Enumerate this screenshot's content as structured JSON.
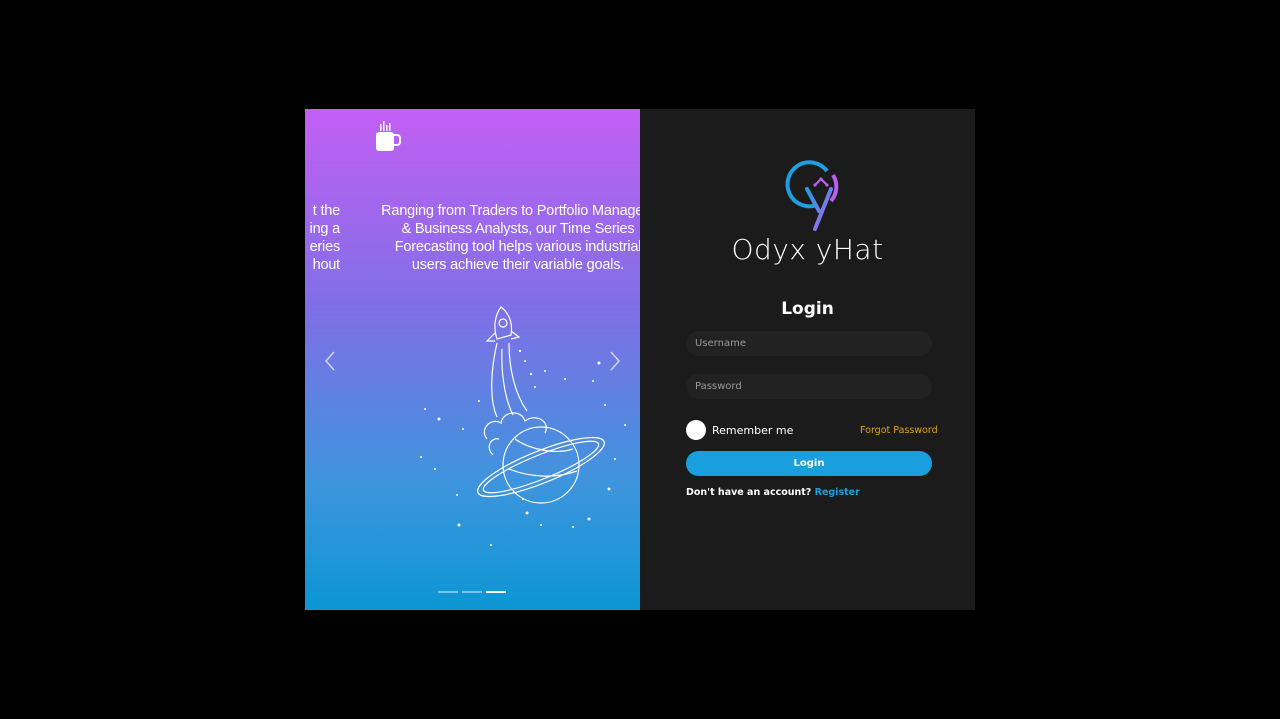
{
  "carousel": {
    "previous_slide_lines": [
      "t the",
      "ing a",
      "eries",
      "hout"
    ],
    "current_slide_lines": [
      "Ranging from Traders to Portfolio Managers",
      "& Business Analysts, our Time Series",
      "Forecasting tool helps various industrial",
      "users achieve their variable goals."
    ],
    "indicators": 3,
    "active_indicator": 3,
    "prev_icon": "chevron-left-icon",
    "next_icon": "chevron-right-icon"
  },
  "brand": {
    "name": "Odyx yHat",
    "accent_colors": [
      "#1e9fe0",
      "#b95ff3"
    ]
  },
  "login": {
    "title": "Login",
    "username_placeholder": "Username",
    "password_placeholder": "Password",
    "remember_label": "Remember me",
    "forgot_label": "Forgot Password",
    "submit_label": "Login",
    "no_account_text": "Don't have an account?",
    "register_label": "Register",
    "button_color": "#1a9fde",
    "forgot_color": "#e0a516"
  }
}
